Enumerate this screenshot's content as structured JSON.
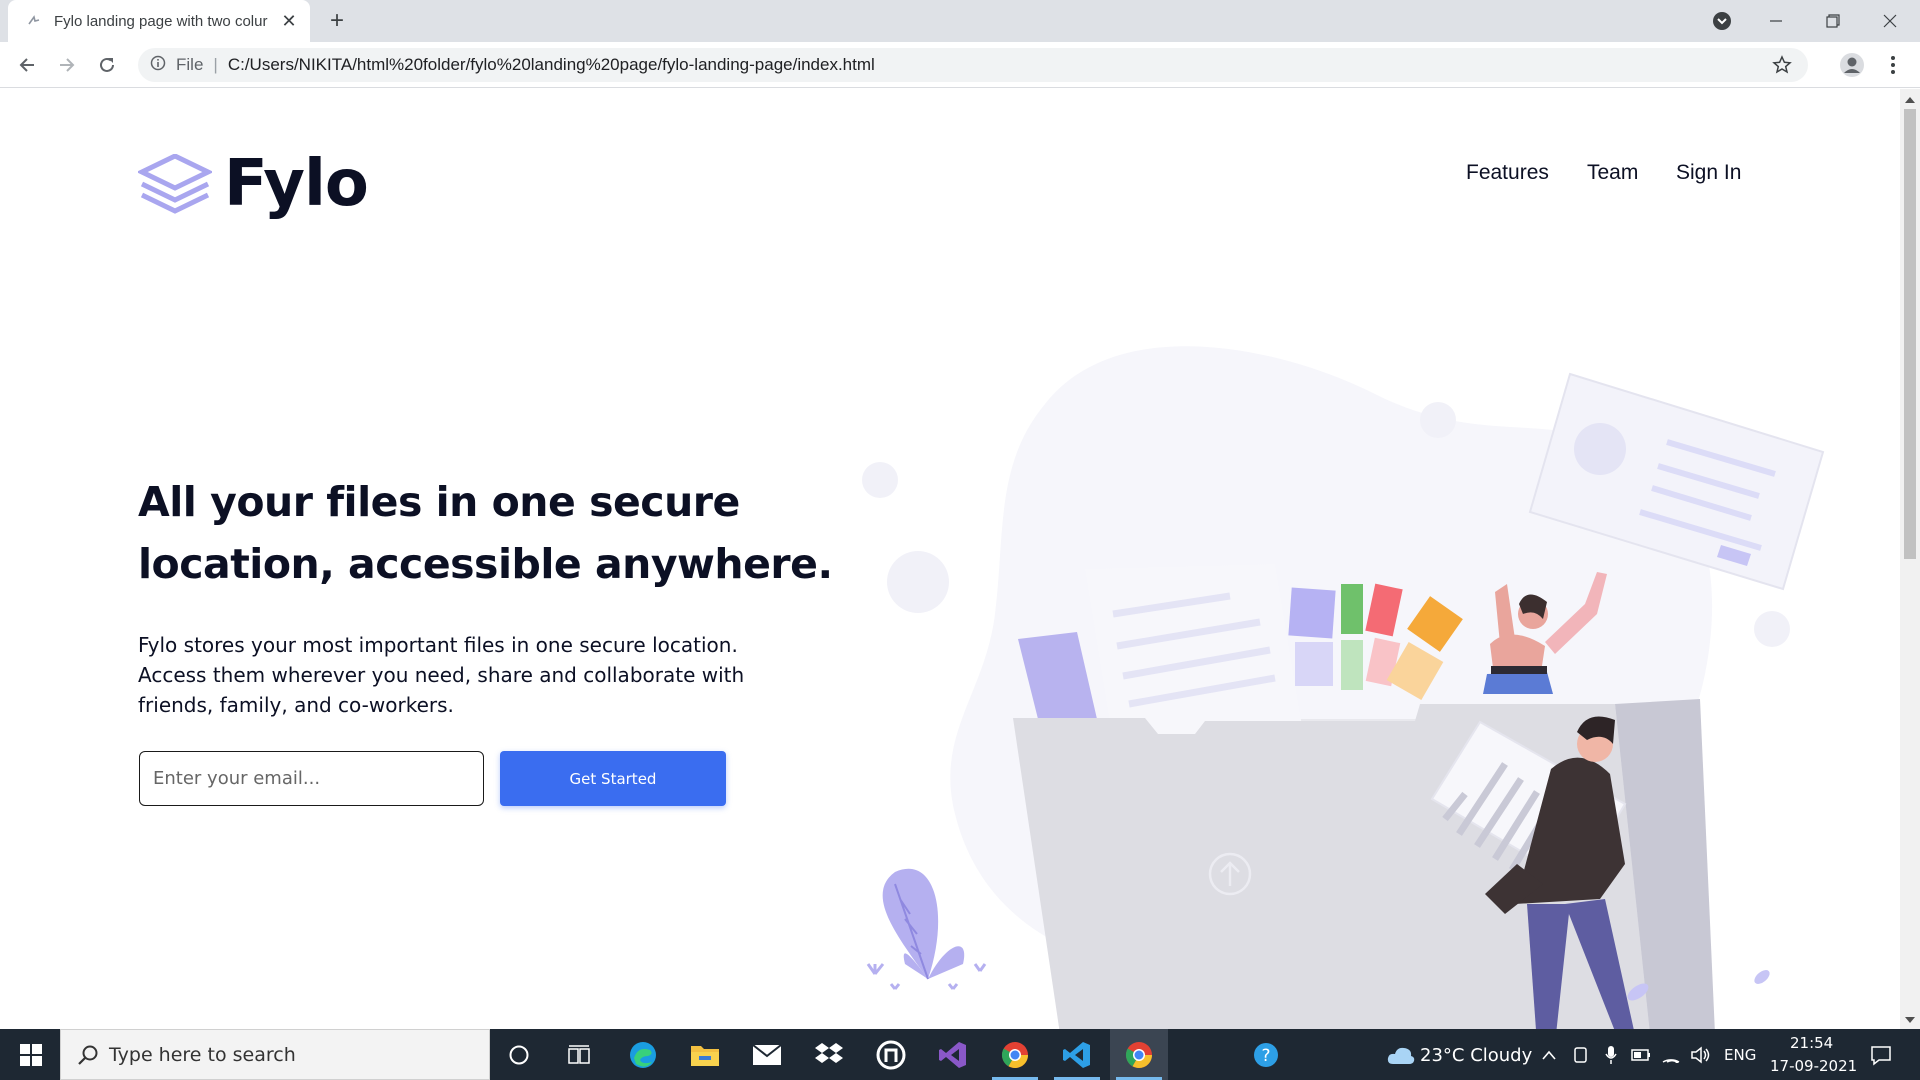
{
  "browser": {
    "tab_title": "Fylo landing page with two colur",
    "tab_close": "✕",
    "new_tab": "+",
    "address": {
      "scheme_label": "File",
      "url": "C:/Users/NIKITA/html%20folder/fylo%20landing%20page/fylo-landing-page/index.html"
    }
  },
  "page": {
    "logo_text": "Fylo",
    "nav": [
      "Features",
      "Team",
      "Sign In"
    ],
    "headline_line1": "All your files in one secure",
    "headline_line2": "location, accessible anywhere.",
    "body": "Fylo stores your most important files in one secure location. Access them wherever you need, share and collaborate with friends, family, and co-workers.",
    "email_placeholder": "Enter your email...",
    "cta_label": "Get Started"
  },
  "taskbar": {
    "search_placeholder": "Type here to search",
    "weather": "23°C  Cloudy",
    "lang": "ENG",
    "time": "21:54",
    "date": "17-09-2021"
  },
  "colors": {
    "brand_dark": "#0c1024",
    "cta_blue": "#3a6df0",
    "logo_purple": "#a9a6ef"
  }
}
